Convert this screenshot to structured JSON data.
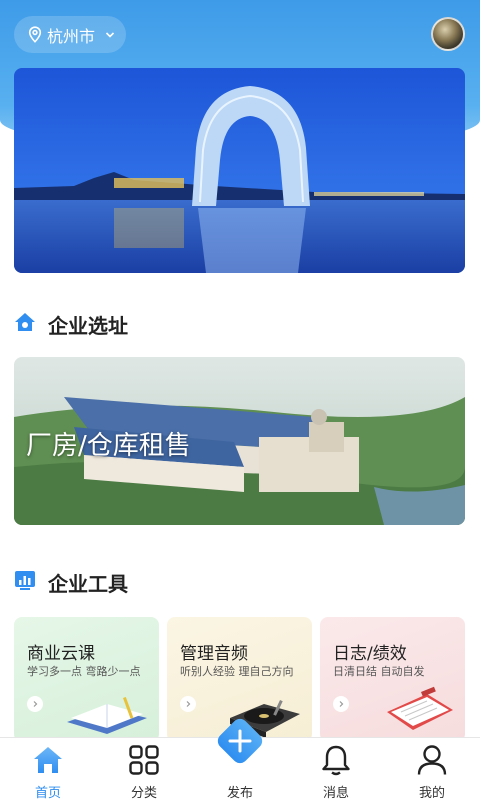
{
  "location": {
    "city": "杭州市"
  },
  "sections": {
    "site": {
      "title": "企业选址",
      "card_label": "厂房/仓库租售"
    },
    "tools": {
      "title": "企业工具",
      "cards": [
        {
          "title": "商业云课",
          "subtitle": "学习多一点 弯路少一点",
          "icon": "book-icon"
        },
        {
          "title": "管理音频",
          "subtitle": "听别人经验 理自己方向",
          "icon": "record-player-icon"
        },
        {
          "title": "日志/绩效",
          "subtitle": "日清日结 自动自发",
          "icon": "clipboard-icon"
        }
      ]
    }
  },
  "tabbar": {
    "items": [
      {
        "label": "首页",
        "icon": "home-icon",
        "active": true
      },
      {
        "label": "分类",
        "icon": "grid-icon",
        "active": false
      },
      {
        "label": "发布",
        "icon": "plus-icon",
        "active": false
      },
      {
        "label": "消息",
        "icon": "bell-icon",
        "active": false
      },
      {
        "label": "我的",
        "icon": "user-icon",
        "active": false
      }
    ]
  },
  "colors": {
    "accent": "#2f8ef0",
    "header": "#4aa3ec"
  }
}
